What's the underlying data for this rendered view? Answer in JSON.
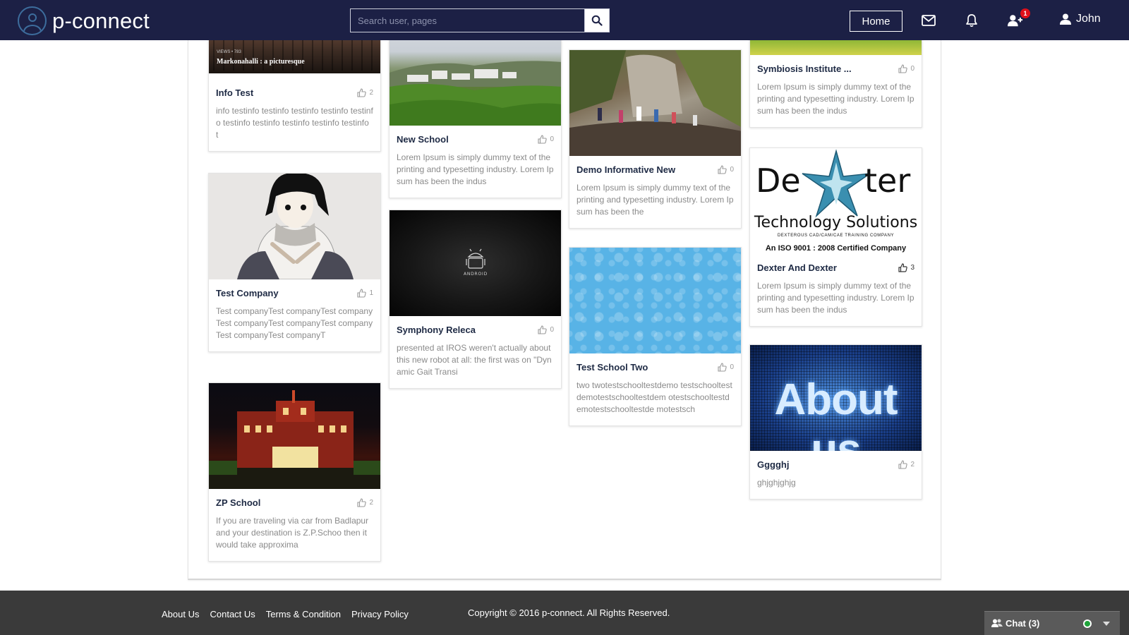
{
  "app": {
    "logo_text": "p-connect",
    "search_placeholder": "Search user, pages",
    "home_label": "Home",
    "friend_request_count": "1",
    "user_name": "John"
  },
  "cards": [
    {
      "title": "Info Test",
      "likes": "2",
      "desc": "info testinfo testinfo testinfo testinfo testinfo testinfo testinfo testinfo testinfo testinfo t",
      "image": "lake-landscape-image",
      "image_caption": "Markonahalli : a picturesque",
      "image_views": "VIEWS • 783"
    },
    {
      "title": "Test Company",
      "likes": "1",
      "desc": "Test companyTest companyTest companyTest companyTest companyTest companyTest companyTest companyT",
      "image": "anime-character-image"
    },
    {
      "title": "ZP School",
      "likes": "2",
      "desc": "If you are traveling via car from Badlapur and your destination is Z.P.Schoo then it would take approxima",
      "image": "school-building-night-image"
    },
    {
      "title": "New School",
      "likes": "0",
      "desc": "Lorem Ipsum is simply dummy text of the printing and typesetting industry. Lorem Ipsum has been the indus",
      "image": "campus-hillside-image"
    },
    {
      "title": "Symphony Releca",
      "likes": "0",
      "desc": "presented at IROS weren't actually about this new robot at all: the first was on \"Dynamic Gait Transi",
      "image": "android-logo-image"
    },
    {
      "title": "Demo Informative New",
      "likes": "0",
      "desc": "Lorem Ipsum is simply dummy text of the printing and typesetting industry. Lorem Ipsum has been the",
      "image": "waterfall-hikers-image"
    },
    {
      "title": "Test School Two",
      "likes": "0",
      "desc": "two twotestschooltestdemo testschooltestdemotestschooltestdem otestschooltestdemotestschooltestde motestsch",
      "image": "blue-pattern-image"
    },
    {
      "title": "Symbiosis Institute ...",
      "likes": "0",
      "desc": "Lorem Ipsum is simply dummy text of the printing and typesetting industry. Lorem Ipsum has been the indus",
      "image": "green-field-image"
    },
    {
      "title": "Dexter And Dexter",
      "likes": "3",
      "desc": "Lorem Ipsum is simply dummy text of the printing and typesetting industry. Lorem Ipsum has been the indus",
      "image": "dexter-logo-image",
      "logo_word_left": "De",
      "logo_word_right": "ter",
      "logo_sub": "Technology Solutions",
      "logo_tag": "Dexterous CAD/CAM/CAE Training Company",
      "logo_iso": "An ISO 9001 : 2008 Certified Company"
    },
    {
      "title": "Gggghj",
      "likes": "2",
      "desc": "ghjghjghjg",
      "image": "about-us-image",
      "image_text": "About us"
    }
  ],
  "footer": {
    "links": [
      "About Us",
      "Contact Us",
      "Terms & Condition",
      "Privacy Policy"
    ],
    "copyright": "Copyright © 2016 p-connect. All Rights Reserved."
  },
  "chat": {
    "label": "Chat (3)"
  }
}
